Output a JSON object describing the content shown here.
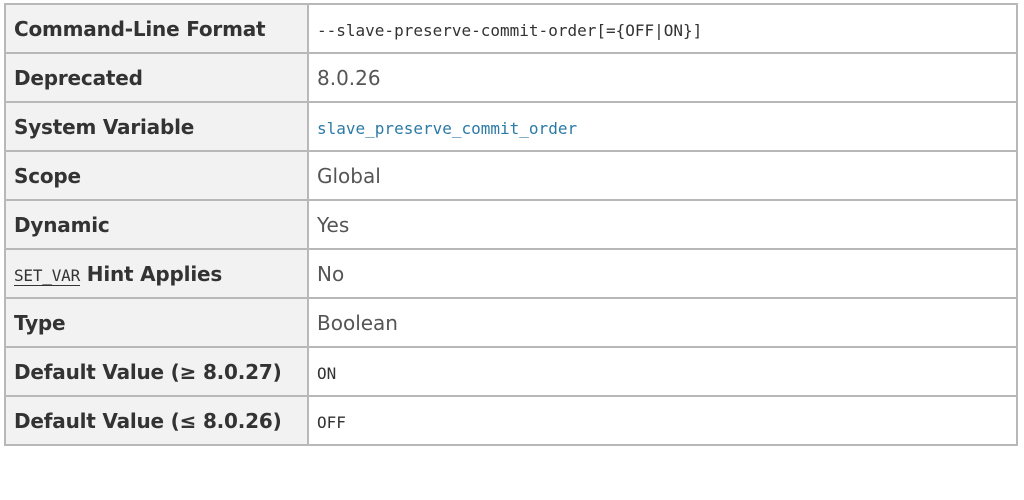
{
  "rows": [
    {
      "label": "Command-Line Format",
      "value": "--slave-preserve-commit-order[={OFF|ON}]"
    },
    {
      "label": "Deprecated",
      "value": "8.0.26"
    },
    {
      "label": "System Variable",
      "value": "slave_preserve_commit_order"
    },
    {
      "label": "Scope",
      "value": "Global"
    },
    {
      "label": "Dynamic",
      "value": "Yes"
    },
    {
      "label_code": "SET_VAR",
      "label_suffix": " Hint Applies",
      "value": "No"
    },
    {
      "label": "Type",
      "value": "Boolean"
    },
    {
      "label": "Default Value (≥ 8.0.27)",
      "value": "ON"
    },
    {
      "label": "Default Value (≤ 8.0.26)",
      "value": "OFF"
    }
  ],
  "colors": {
    "border": "#b8b8b8",
    "label_bg": "#f2f2f2",
    "link": "#2c7aa6"
  }
}
